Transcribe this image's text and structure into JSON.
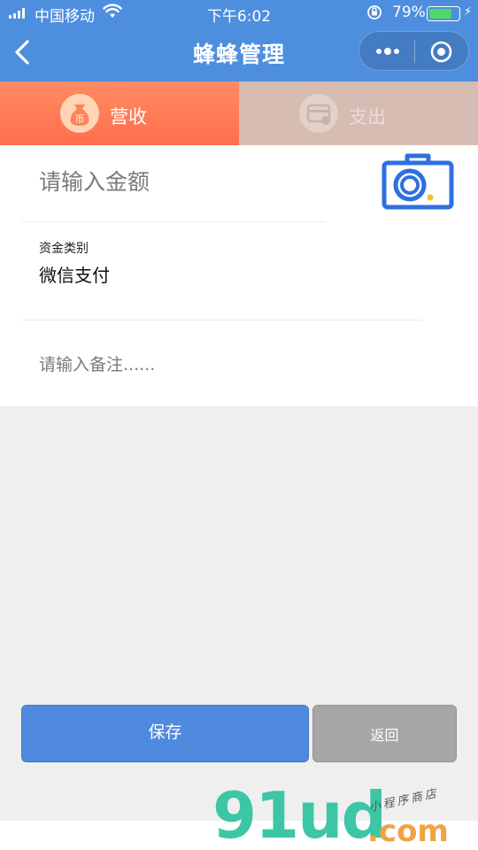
{
  "status_bar": {
    "carrier": "中国移动",
    "time": "下午6:02",
    "battery_percent": "79%",
    "battery_level": 0.79,
    "icons": [
      "signal-icon",
      "wifi-icon",
      "orientation-lock-icon",
      "battery-icon",
      "charging-icon"
    ]
  },
  "nav": {
    "title": "蜂蜂管理",
    "back_icon": "chevron-left-icon",
    "capsule_icons": [
      "more-icon",
      "close-target-icon"
    ]
  },
  "tabs": [
    {
      "label": "营收",
      "icon": "money-bag-icon",
      "active": true
    },
    {
      "label": "支出",
      "icon": "card-icon",
      "active": false
    }
  ],
  "form": {
    "amount_placeholder": "请输入金额",
    "camera_icon": "camera-icon",
    "fund_category_label": "资金类别",
    "fund_category_value": "微信支付",
    "remark_placeholder": "请输入备注......"
  },
  "actions": {
    "save_label": "保存",
    "back_label": "返回"
  },
  "watermark": {
    "logo": "91ud",
    "suffix": ".com",
    "tagline": "小程序商店"
  },
  "colors": {
    "nav_bg": "#4e8ede",
    "income_tab": "#ff7a55",
    "expense_tab": "#d6bcb3",
    "save_button": "#508ade",
    "back_button": "#a6a6a6",
    "camera_icon": "#2f6fe0"
  }
}
